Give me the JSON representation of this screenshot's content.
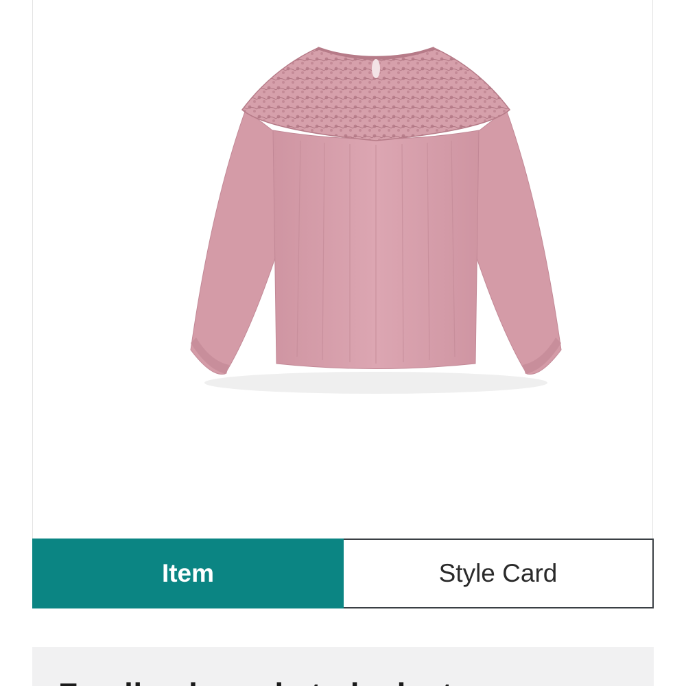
{
  "tabs": {
    "item_label": "Item",
    "style_card_label": "Style Card"
  },
  "product": {
    "image_icon": "pink-lace-yoke-blouse-image",
    "colors": {
      "blouse": "#d9a2ae",
      "blouse_shadow": "#c78d9a",
      "lace": "#c98f9c"
    }
  },
  "details": {
    "title": "Feedback ready to be last"
  },
  "colors": {
    "accent": "#0b8583",
    "panel": "#f1f1f2"
  }
}
